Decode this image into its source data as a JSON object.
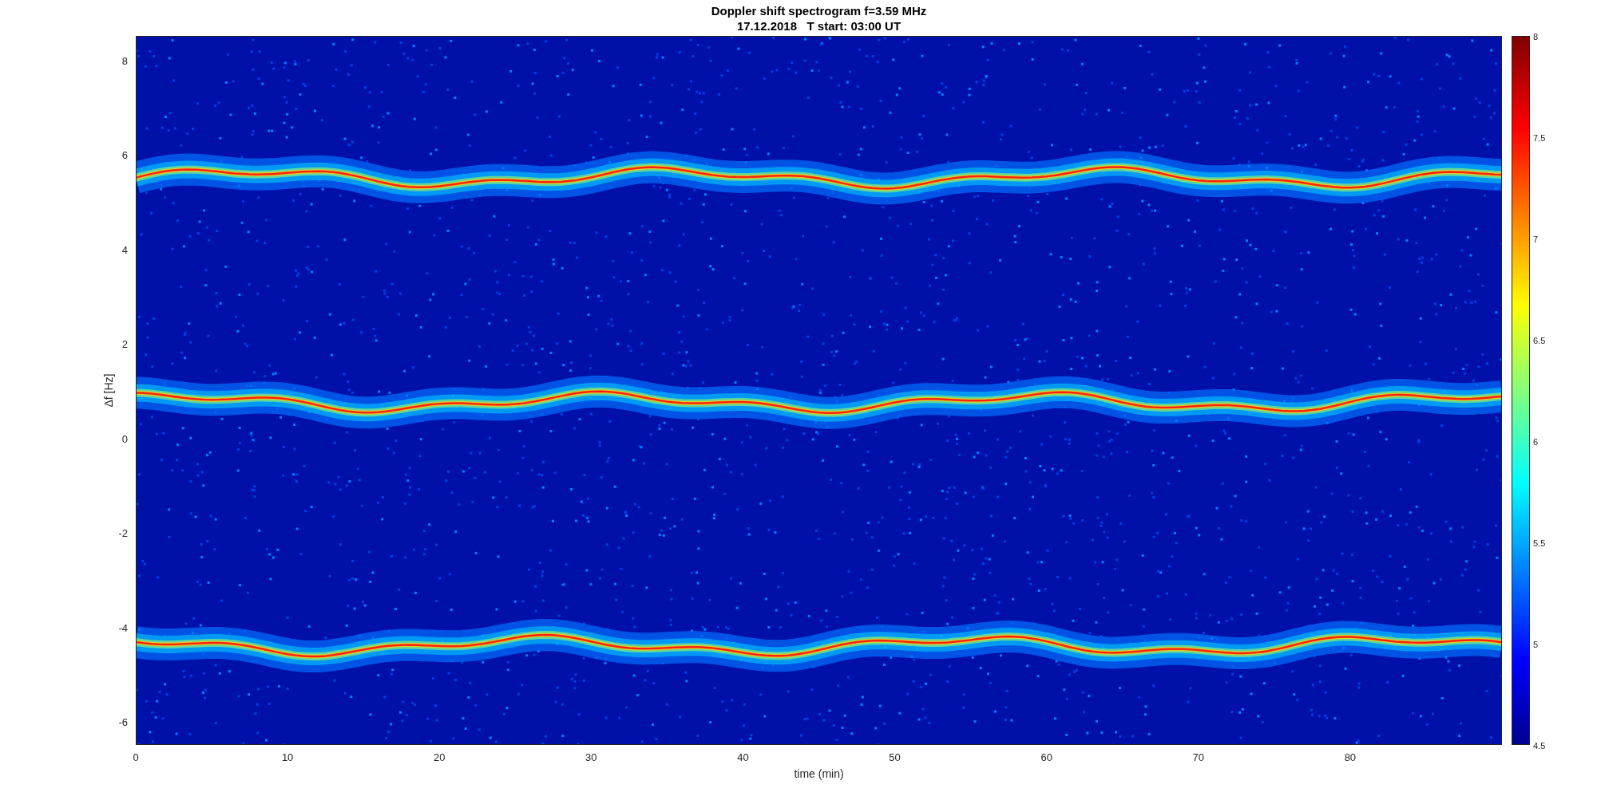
{
  "title": [
    "Doppler shift spectrogram f=3.59 MHz",
    "17.12.2018   T start: 03:00 UT"
  ],
  "xlabel": "time (min)",
  "ylabel": "Δf [Hz]",
  "xticks": [
    "0",
    "10",
    "20",
    "30",
    "40",
    "50",
    "60",
    "70",
    "80"
  ],
  "yticks": [
    "8",
    "6",
    "4",
    "2",
    "0",
    "-2",
    "-4",
    "-6"
  ],
  "colorbar": {
    "ticks": [
      "8",
      "7.5",
      "7",
      "6.5",
      "6",
      "5.5",
      "5",
      "4.5"
    ]
  }
}
